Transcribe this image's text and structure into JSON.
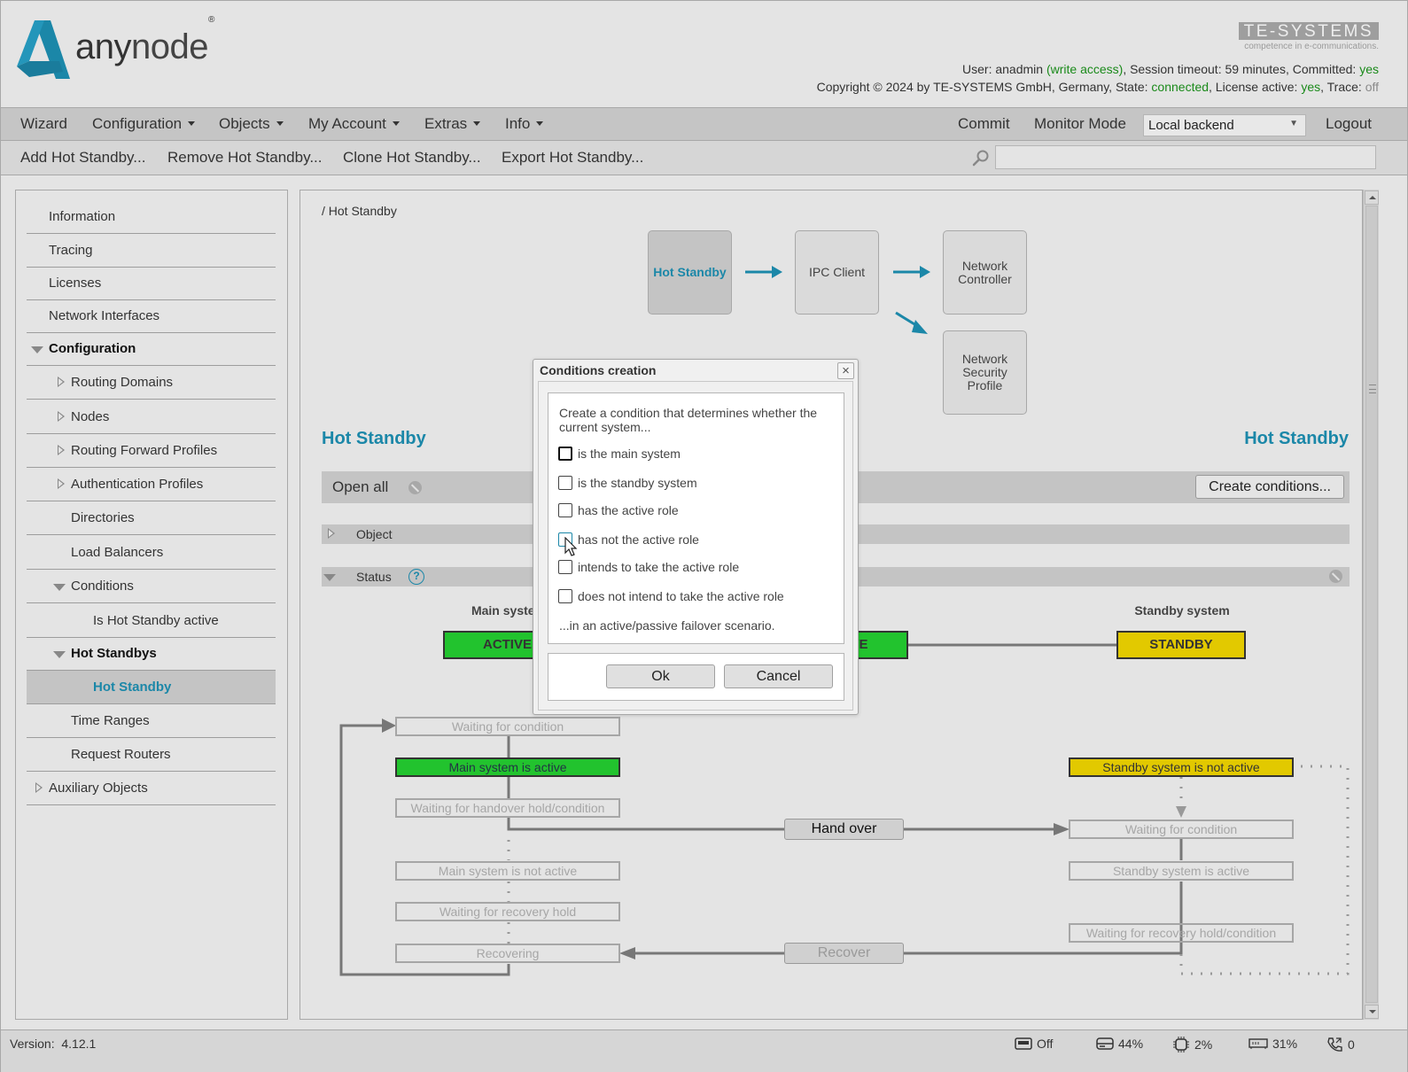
{
  "header": {
    "logo_any": "any",
    "logo_node": "node",
    "logo_reg": "®",
    "brand": "TE-SYSTEMS",
    "brand_tagline": "competence in e-communications.",
    "user_prefix": "User: ",
    "user": "anadmin",
    "access": "(write access)",
    "session_text": ", Session timeout: 59 minutes, Committed: ",
    "committed": "yes",
    "copyright": "Copyright © 2024 by TE-SYSTEMS GmbH, Germany, State: ",
    "state": "connected",
    "license_label": ", License active: ",
    "license": "yes",
    "trace_label": ", Trace: ",
    "trace": "off"
  },
  "nav": {
    "items": [
      {
        "label": "Wizard",
        "dropdown": false
      },
      {
        "label": "Configuration",
        "dropdown": true
      },
      {
        "label": "Objects",
        "dropdown": true
      },
      {
        "label": "My Account",
        "dropdown": true
      },
      {
        "label": "Extras",
        "dropdown": true
      },
      {
        "label": "Info",
        "dropdown": true
      }
    ],
    "commit": "Commit",
    "monitor_mode": "Monitor Mode",
    "backend": "Local backend",
    "logout": "Logout"
  },
  "toolbar": {
    "add": "Add Hot Standby...",
    "remove": "Remove Hot Standby...",
    "clone": "Clone Hot Standby...",
    "export": "Export Hot Standby...",
    "search_value": ""
  },
  "sidebar": {
    "items": [
      {
        "label": "Information"
      },
      {
        "label": "Tracing"
      },
      {
        "label": "Licenses"
      },
      {
        "label": "Network Interfaces"
      },
      {
        "label": "Configuration",
        "expanded": true
      },
      {
        "label": "Routing Domains"
      },
      {
        "label": "Nodes"
      },
      {
        "label": "Routing Forward Profiles"
      },
      {
        "label": "Authentication Profiles"
      },
      {
        "label": "Directories"
      },
      {
        "label": "Load Balancers"
      },
      {
        "label": "Conditions",
        "expanded": true
      },
      {
        "label": "Is Hot Standby active"
      },
      {
        "label": "Hot Standbys",
        "expanded": true
      },
      {
        "label": "Hot Standby",
        "selected": true
      },
      {
        "label": "Time Ranges"
      },
      {
        "label": "Request Routers"
      },
      {
        "label": "Auxiliary Objects"
      }
    ]
  },
  "main": {
    "breadcrumb": "/ Hot Standby",
    "flow": {
      "current": "Hot Standby",
      "ipc": "IPC Client",
      "netctrl_1": "Network",
      "netctrl_2": "Controller",
      "netsec_1": "Network",
      "netsec_2": "Security",
      "netsec_3": "Profile"
    },
    "title_left": "Hot Standby",
    "title_right": "Hot Standby",
    "open_all": "Open all",
    "create_conditions": "Create conditions...",
    "section_object": "Object",
    "section_status": "Status",
    "help": "?",
    "status": {
      "main_label": "Main system",
      "standby_label": "Standby system",
      "main_role": "ACTIVE",
      "middle_role": "ACTIVE",
      "standby_role": "STANDBY",
      "main_states": [
        "Waiting for condition",
        "Main system is active",
        "Waiting for handover hold/condition",
        "Main system is not active",
        "Waiting for recovery hold",
        "Recovering"
      ],
      "standby_states": [
        "Standby system is not active",
        "Waiting for condition",
        "Standby system is active",
        "Waiting for recovery hold/condition"
      ],
      "hand_over": "Hand over",
      "recover": "Recover"
    }
  },
  "dialog": {
    "title": "Conditions creation",
    "close": "×",
    "intro": "Create a condition that determines whether the current system...",
    "options": [
      {
        "label": "is the main system",
        "checked": false
      },
      {
        "label": "is the standby system",
        "checked": false
      },
      {
        "label": "has the active role",
        "checked": false
      },
      {
        "label": "has not the active role",
        "checked": false
      },
      {
        "label": "intends to take the active role",
        "checked": false
      },
      {
        "label": "does not intend to take the active role",
        "checked": false
      }
    ],
    "outro": "...in an active/passive failover scenario.",
    "ok": "Ok",
    "cancel": "Cancel"
  },
  "statusbar": {
    "version_label": "Version:",
    "version": "4.12.1",
    "recording": "Off",
    "disk": "44%",
    "cpu": "2%",
    "memory": "31%",
    "calls": "0"
  },
  "colors": {
    "accent": "#1b87a8",
    "active_green": "#22c32e",
    "standby_yellow": "#e2c900",
    "ok_green": "#1a8a1a"
  }
}
